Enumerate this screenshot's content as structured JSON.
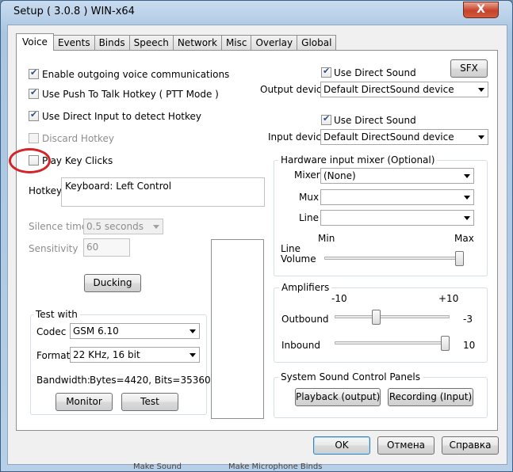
{
  "window": {
    "title": "Setup ( 3.0.8 ) WIN-x64",
    "close_glyph": "X"
  },
  "tabs": [
    "Voice",
    "Events",
    "Binds",
    "Speech",
    "Network",
    "Misc",
    "Overlay",
    "Global"
  ],
  "active_tab": "Voice",
  "voice": {
    "enable_outgoing": {
      "label": "Enable outgoing voice communications",
      "checked": true
    },
    "use_ptt": {
      "label": "Use Push To Talk Hotkey ( PTT Mode )",
      "checked": true
    },
    "use_direct_input": {
      "label": "Use Direct Input to detect Hotkey",
      "checked": true
    },
    "discard_hotkey": {
      "label": "Discard Hotkey",
      "checked": false,
      "enabled": false
    },
    "play_key_clicks": {
      "label": "Play Key Clicks",
      "checked": false
    },
    "hotkey_label": "Hotkey",
    "hotkey_value": "Keyboard: Left Control",
    "silence_time_label": "Silence time",
    "silence_time_value": "0.5 seconds",
    "sensitivity_label": "Sensitivity",
    "sensitivity_value": "60",
    "ducking_button": "Ducking"
  },
  "test_with": {
    "title": "Test with",
    "codec_label": "Codec",
    "codec_value": "GSM 6.10",
    "format_label": "Format",
    "format_value": "22 KHz, 16 bit",
    "bandwidth_label": "Bandwidth:",
    "bandwidth_value": "Bytes=4420, Bits=35360",
    "monitor_button": "Monitor",
    "test_button": "Test"
  },
  "output": {
    "sfx_button": "SFX",
    "use_direct_sound": {
      "label": "Use Direct Sound",
      "checked": true
    },
    "device_label": "Output device",
    "device_value": "Default DirectSound device"
  },
  "input": {
    "use_direct_sound": {
      "label": "Use Direct Sound",
      "checked": true
    },
    "device_label": "Input device",
    "device_value": "Default DirectSound device"
  },
  "mixer": {
    "title": "Hardware input mixer (Optional)",
    "mixer_label": "Mixer",
    "mixer_value": "(None)",
    "mux_label": "Mux",
    "mux_value": "",
    "line_label": "Line",
    "line_value": "",
    "min_label": "Min",
    "max_label": "Max",
    "line_volume_label_1": "Line",
    "line_volume_label_2": "Volume",
    "line_volume_level": 1.0
  },
  "amplifiers": {
    "title": "Amplifiers",
    "min_label": "-10",
    "max_label": "+10",
    "outbound_label": "Outbound",
    "outbound_value": "-3",
    "outbound_level": -3,
    "inbound_label": "Inbound",
    "inbound_value": "10",
    "inbound_level": 10
  },
  "system_sound": {
    "title": "System Sound Control Panels",
    "playback_button": "Playback (output)",
    "recording_button": "Recording (Input)"
  },
  "footer": {
    "ok": "OK",
    "cancel": "Отмена",
    "help": "Справка"
  },
  "background_text": [
    "Make Sound",
    "Make Microphone Binds"
  ],
  "colors": {
    "highlight_circle": "#d3242a",
    "close_button": "#c8412a"
  }
}
